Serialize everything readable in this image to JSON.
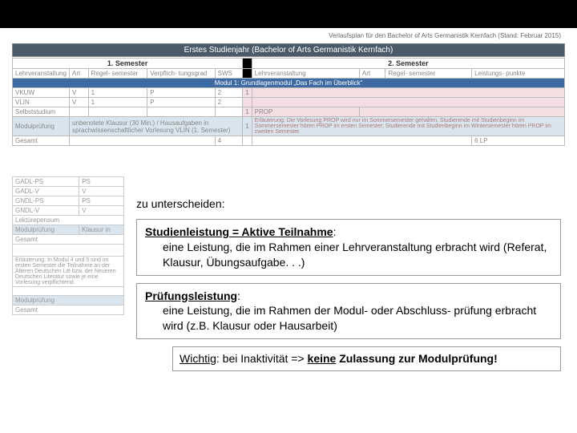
{
  "doc_header": "Verlaufsplan für den Bachelor of Arts Germanistik Kernfach (Stand: Februar 2015)",
  "section_title": "Erstes Studienjahr (Bachelor of Arts Germanistik Kernfach)",
  "sem1": "1. Semester",
  "sem2": "2. Semester",
  "hdr": {
    "lv": "Lehrveranstaltung",
    "art": "Art",
    "regel": "Regel-\nsemester",
    "verpf": "Verpflich-\ntungsgrad",
    "sws": "SWS",
    "lv2": "Lehrveranstaltung",
    "art2": "Art",
    "regel2": "Regel-\nsemester",
    "lp": "Leistungs-\npunkte"
  },
  "mod1": "Modul 1: Grundlagenmodul „Das Fach im Überblick“",
  "row1": {
    "a": "VKUW",
    "b": "V",
    "c": "1",
    "d": "P",
    "e": "2",
    "f": "1"
  },
  "row2": {
    "a": "VLIN",
    "b": "V",
    "c": "1",
    "d": "P",
    "e": "2",
    "f": ""
  },
  "row3": {
    "a": "Selbststudium",
    "f": "1",
    "f2": "PROP"
  },
  "rowmp": {
    "a": "Modulprüfung",
    "b": "unbenotete Klausur (30 Min.) / Hausaufgaben in sprachwissenschaftlicher Vorlesung VLIN (1. Semester)",
    "c": "1",
    "erl": "Erläuterung: Die Vorlesung PROP wird nur im Sommersemester gehalten. Studierende mit Studienbeginn im Sommersemester hören PROP im ersten Semester; Studierende mit Studienbeginn im Wintersemester hören PROP im zweiten Semester."
  },
  "ges": {
    "a": "Gesamt",
    "b": "4",
    "c": "6 LP"
  },
  "left": {
    "r1": "GADL-PS",
    "r1b": "PS",
    "r2": "GADL-V",
    "r2b": "V",
    "r3": "GNDL-PS",
    "r3b": "PS",
    "r4": "GNDL-V",
    "r4b": "V",
    "r5": "Lektürepensum",
    "mp": "Modulprüfung",
    "mpb": "Klausur in",
    "ges": "Gesamt",
    "erl": "Erläuterung: In Modul 4 und 5 sind im ersten Semester die Teilnahme an der Älteren Deutschen Litt bzw. der Neueren Deutschen Literatur sowie je eine Vorlesung verpflichtend.",
    "mp2": "Modulprüfung",
    "ges2": "Gesamt"
  },
  "content": {
    "intro": "zu unterscheiden:",
    "b1_head": "Studienleistung = Aktive Teilnahme",
    "b1_body": "eine Leistung, die im Rahmen einer Lehrveranstaltung erbracht wird (Referat, Klausur, Übungsaufgabe. . .)",
    "b2_head": "Prüfungsleistung",
    "b2_body": "eine Leistung, die im Rahmen der Modul- oder Abschluss-\nprüfung erbracht wird (z.B. Klausur oder Hausarbeit)",
    "b3_pre": "Wichtig",
    "b3_mid": ": bei Inaktivität => ",
    "b3_s1": "keine",
    "b3_s2": " Zulassung zur Modulprüfung!"
  }
}
